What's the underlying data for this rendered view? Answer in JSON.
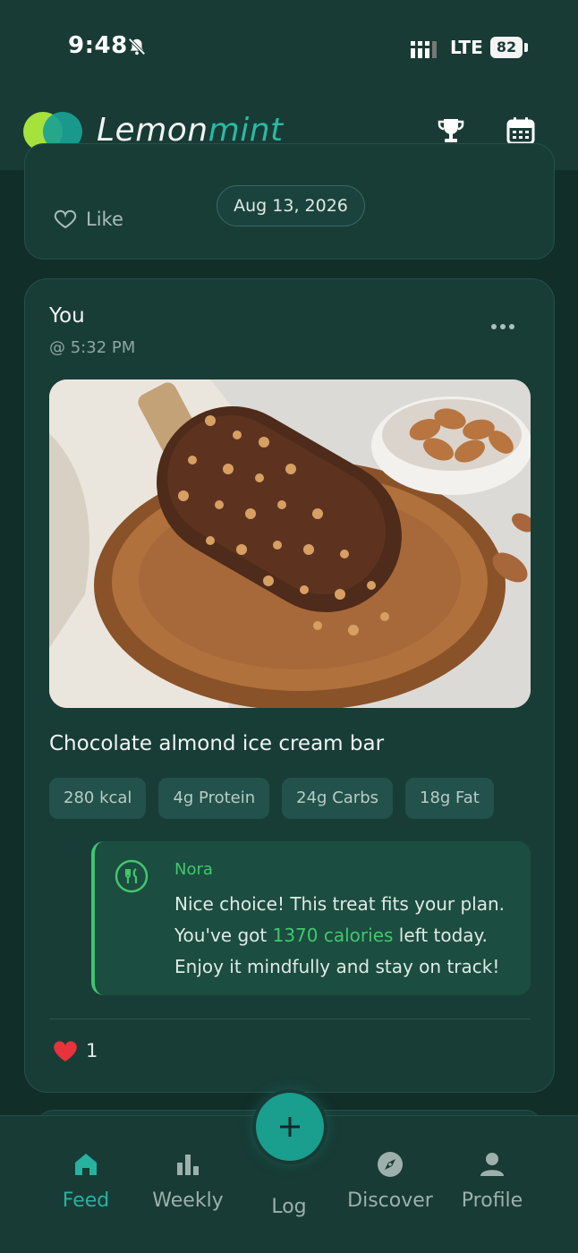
{
  "status_bar": {
    "time": "9:48",
    "network": "LTE",
    "battery": "82"
  },
  "app": {
    "brand_first": "Lemon",
    "brand_second": "mint"
  },
  "previous_post": {
    "like_label": "Like",
    "date": "Aug 13, 2026"
  },
  "post": {
    "author": "You",
    "time": "@ 5:32 PM",
    "food_name": "Chocolate almond ice cream bar",
    "nutrition": [
      {
        "label": "280 kcal"
      },
      {
        "label": "4g Protein"
      },
      {
        "label": "24g Carbs"
      },
      {
        "label": "18g Fat"
      }
    ],
    "coach": {
      "name": "Nora",
      "text_1": "Nice choice! This treat fits your plan. You've got ",
      "highlight": "1370 calories",
      "text_2": " left today. Enjoy it mindfully and stay on track!"
    },
    "like_count": "1"
  },
  "nav": {
    "feed": "Feed",
    "weekly": "Weekly",
    "log": "Log",
    "discover": "Discover",
    "profile": "Profile"
  },
  "colors": {
    "background": "#122e29",
    "accent": "#25b3a0",
    "coach_green": "#42c76d",
    "heart_red": "#e8323c"
  }
}
